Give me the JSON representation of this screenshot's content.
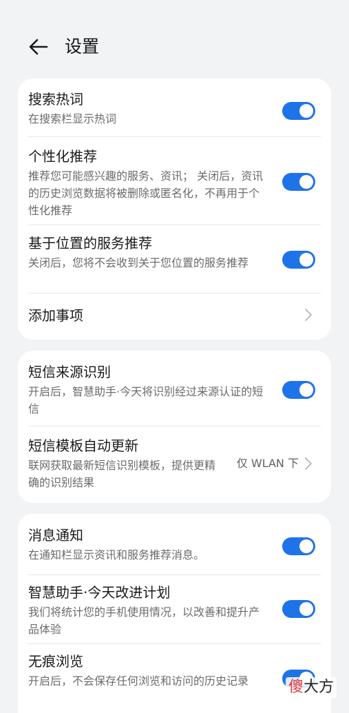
{
  "header": {
    "title": "设置"
  },
  "cards": [
    {
      "rows": [
        {
          "title": "搜索热词",
          "subtitle": "在搜索栏显示热词",
          "toggle": true
        },
        {
          "title": "个性化推荐",
          "subtitle": "推荐您可能感兴趣的服务、资讯； 关闭后，资讯的历史浏览数据将被删除或匿名化，不再用于个性化推荐",
          "toggle": true
        },
        {
          "title": "基于位置的服务推荐",
          "subtitle": "关闭后，您将不会收到关于您位置的服务推荐",
          "toggle": true
        },
        {
          "title": "添加事项"
        }
      ]
    },
    {
      "rows": [
        {
          "title": "短信来源识别",
          "subtitle": "开启后，智慧助手·今天将识别经过来源认证的短信",
          "toggle": true
        },
        {
          "title": "短信模板自动更新",
          "subtitle": "联网获取最新短信识别模板，提供更精确的识别结果",
          "value": "仅 WLAN 下"
        }
      ]
    },
    {
      "rows": [
        {
          "title": "消息通知",
          "subtitle": "在通知栏显示资讯和服务推荐消息。",
          "toggle": true
        },
        {
          "title": "智慧助手·今天改进计划",
          "subtitle": "我们将统计您的手机使用情况，以改善和提升产品体验",
          "toggle": true
        },
        {
          "title": "无痕浏览",
          "subtitle": "开启后，不会保存任何浏览和访问的历史记录",
          "toggle": true
        }
      ]
    }
  ],
  "watermark": {
    "part1": "傻",
    "part2": "大方"
  },
  "colors": {
    "accent": "#1f73e8",
    "card": "#ffffff",
    "background": "#f1f3f5"
  }
}
